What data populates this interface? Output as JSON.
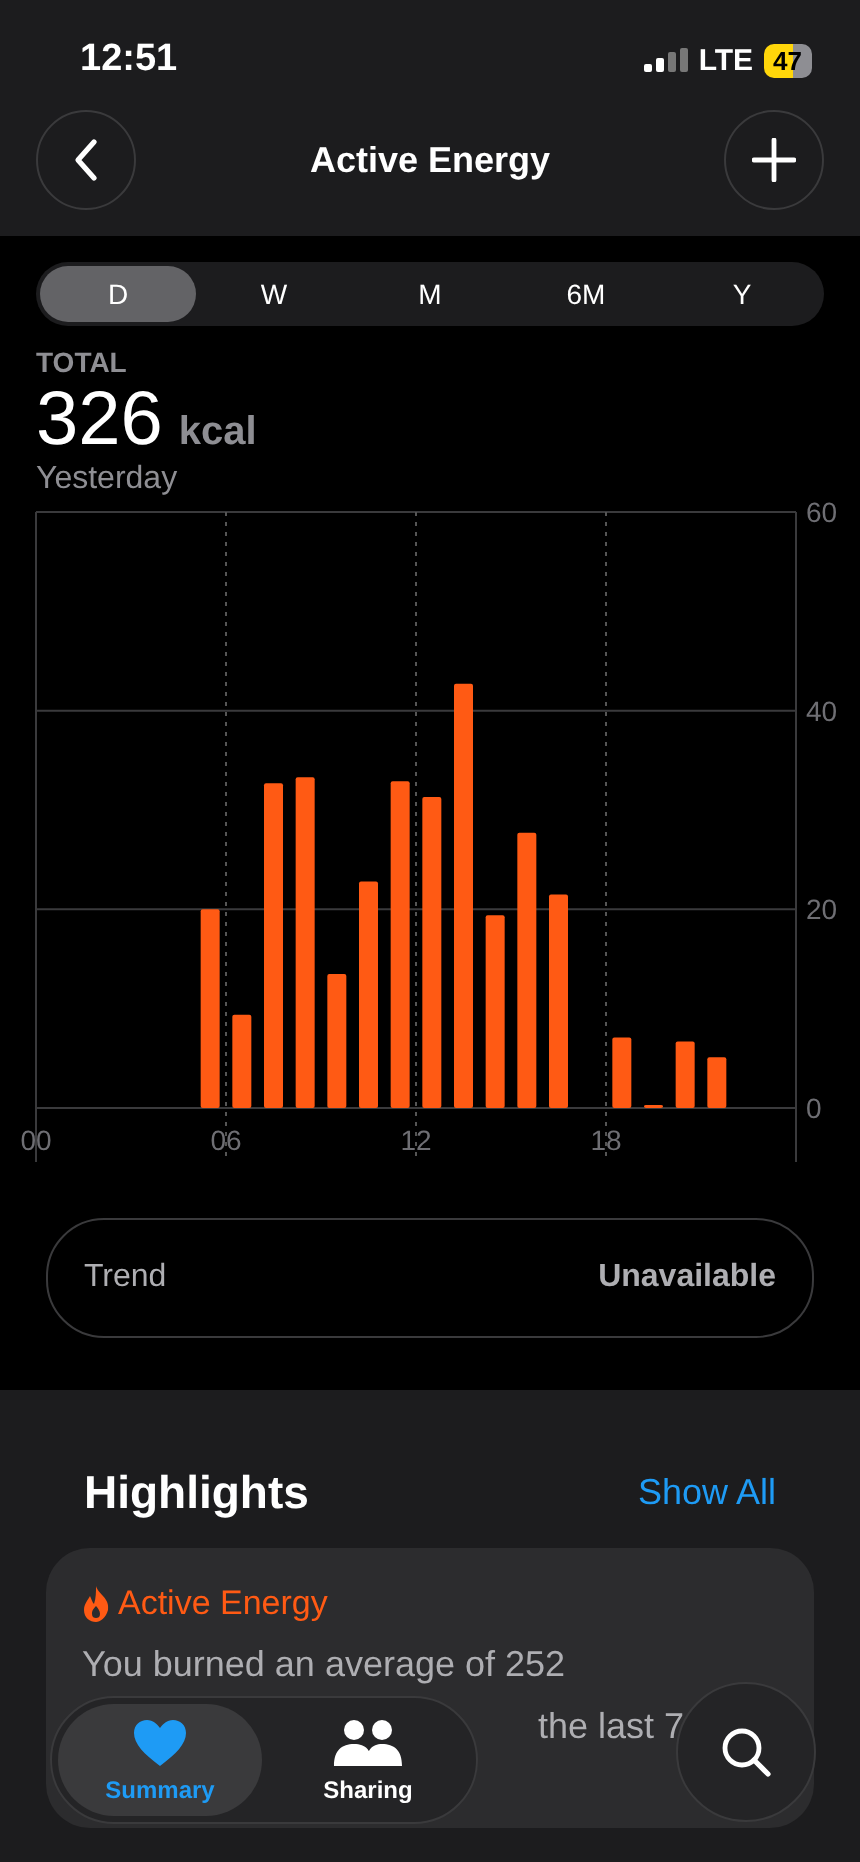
{
  "status_bar": {
    "time": "12:51",
    "network": "LTE",
    "battery": "47"
  },
  "nav": {
    "title": "Active Energy"
  },
  "periods": [
    {
      "label": "D",
      "selected": true
    },
    {
      "label": "W",
      "selected": false
    },
    {
      "label": "M",
      "selected": false
    },
    {
      "label": "6M",
      "selected": false
    },
    {
      "label": "Y",
      "selected": false
    }
  ],
  "summary": {
    "caption": "TOTAL",
    "value": "326",
    "unit": "kcal",
    "date": "Yesterday"
  },
  "chart_data": {
    "type": "bar",
    "x": [
      5.5,
      6.5,
      7.5,
      8.5,
      9.5,
      10.5,
      11.5,
      12.5,
      13.5,
      14.5,
      15.5,
      16.5,
      18.5,
      19.5,
      20.5,
      21.5
    ],
    "xlim": [
      0,
      24
    ],
    "series": [
      {
        "color": "#ff5a14",
        "values": [
          20,
          9.4,
          32.7,
          33.3,
          13.5,
          22.8,
          32.9,
          31.3,
          42.7,
          19.4,
          27.7,
          21.5,
          7.1,
          0.3,
          6.7,
          5.1
        ]
      }
    ],
    "ylim": [
      0,
      60
    ],
    "grid": true,
    "yticks": [
      0,
      20,
      40,
      60
    ],
    "xticks": [
      {
        "value": 0,
        "label": "00"
      },
      {
        "value": 6,
        "label": "06"
      },
      {
        "value": 12,
        "label": "12"
      },
      {
        "value": 18,
        "label": "18"
      }
    ]
  },
  "trend": {
    "label": "Trend",
    "value": "Unavailable"
  },
  "highlights": {
    "title": "Highlights",
    "action": "Show All",
    "card": {
      "title": "Active Energy",
      "line_1": "You burned an average of 252",
      "line_2_visible": "the last 7"
    }
  },
  "tab_bar": [
    {
      "label": "Summary",
      "selected": true
    },
    {
      "label": "Sharing",
      "selected": false
    }
  ]
}
